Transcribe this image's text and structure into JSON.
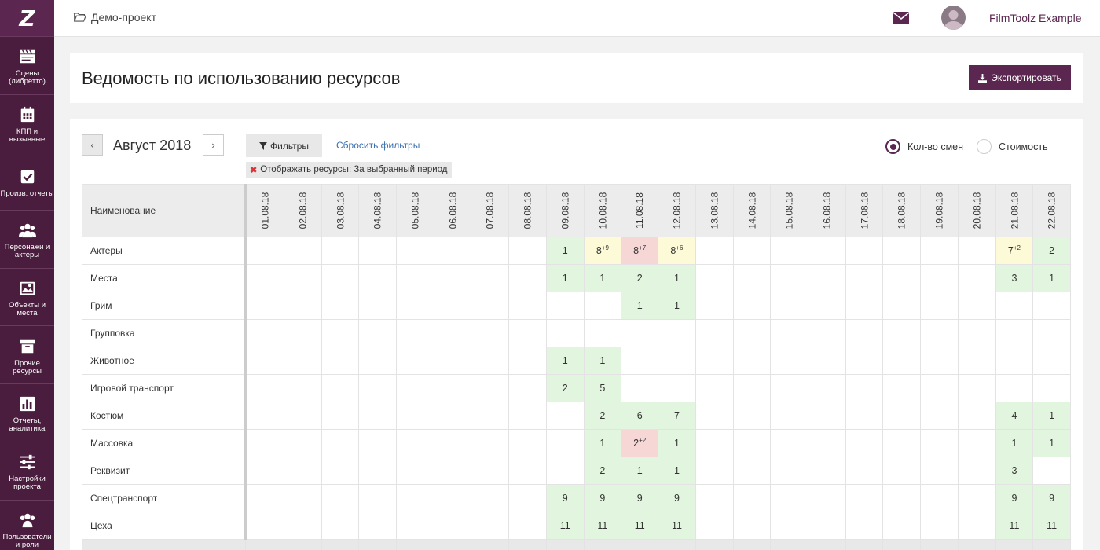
{
  "app": {
    "logo": "Z",
    "project_name": "Демо-проект",
    "user_name": "FilmToolz Example"
  },
  "sidebar": {
    "items": [
      {
        "label": "Сцены (либретто)",
        "icon": "clapperboard-icon"
      },
      {
        "label": "КПП и вызывные",
        "icon": "calendar-icon"
      },
      {
        "label": "Произв. отчеты",
        "icon": "checkbox-icon"
      },
      {
        "label": "Персонажи и актеры",
        "icon": "users-icon"
      },
      {
        "label": "Объекты и места",
        "icon": "image-icon"
      },
      {
        "label": "Прочие ресурсы",
        "icon": "archive-icon"
      },
      {
        "label": "Отчеты, аналитика",
        "icon": "bar-chart-icon"
      },
      {
        "label": "Настройки проекта",
        "icon": "sliders-icon"
      },
      {
        "label": "Пользователи и роли",
        "icon": "group-icon"
      }
    ]
  },
  "header": {
    "title": "Ведомость по использованию ресурсов",
    "export_label": "Экспортировать"
  },
  "toolbar": {
    "prev": "‹",
    "next": "›",
    "month": "Август 2018",
    "filters_label": "Фильтры",
    "reset_label": "Сбросить фильтры",
    "filter_tag": "Отображать ресурсы: За выбранный период",
    "radio_shifts": "Кол-во смен",
    "radio_cost": "Стоимость",
    "selected_mode": "shifts"
  },
  "table": {
    "name_header": "Наименование",
    "dates": [
      "01.08.18",
      "02.08.18",
      "03.08.18",
      "04.08.18",
      "05.08.18",
      "06.08.18",
      "07.08.18",
      "08.08.18",
      "09.08.18",
      "10.08.18",
      "11.08.18",
      "12.08.18",
      "13.08.18",
      "14.08.18",
      "15.08.18",
      "16.08.18",
      "17.08.18",
      "18.08.18",
      "19.08.18",
      "20.08.18",
      "21.08.18",
      "22.08.18"
    ],
    "rows": [
      {
        "name": "Актеры",
        "cells": {
          "9": [
            "1",
            "",
            "g"
          ],
          "10": [
            "8",
            "+9",
            "y"
          ],
          "11": [
            "8",
            "+7",
            "r"
          ],
          "12": [
            "8",
            "+6",
            "y"
          ],
          "21": [
            "7",
            "+2",
            "y"
          ],
          "22": [
            "2",
            "",
            "g"
          ]
        }
      },
      {
        "name": "Места",
        "cells": {
          "9": [
            "1",
            "",
            "g"
          ],
          "10": [
            "1",
            "",
            "g"
          ],
          "11": [
            "2",
            "",
            "g"
          ],
          "12": [
            "1",
            "",
            "g"
          ],
          "21": [
            "3",
            "",
            "g"
          ],
          "22": [
            "1",
            "",
            "g"
          ]
        }
      },
      {
        "name": "Грим",
        "cells": {
          "11": [
            "1",
            "",
            "g"
          ],
          "12": [
            "1",
            "",
            "g"
          ]
        }
      },
      {
        "name": "Групповка",
        "cells": {}
      },
      {
        "name": "Животное",
        "cells": {
          "9": [
            "1",
            "",
            "g"
          ],
          "10": [
            "1",
            "",
            "g"
          ]
        }
      },
      {
        "name": "Игровой транспорт",
        "cells": {
          "9": [
            "2",
            "",
            "g"
          ],
          "10": [
            "5",
            "",
            "g"
          ]
        }
      },
      {
        "name": "Костюм",
        "cells": {
          "10": [
            "2",
            "",
            "g"
          ],
          "11": [
            "6",
            "",
            "g"
          ],
          "12": [
            "7",
            "",
            "g"
          ],
          "21": [
            "4",
            "",
            "g"
          ],
          "22": [
            "1",
            "",
            "g"
          ]
        }
      },
      {
        "name": "Массовка",
        "cells": {
          "10": [
            "1",
            "",
            "g"
          ],
          "11": [
            "2",
            "+2",
            "r"
          ],
          "12": [
            "1",
            "",
            "g"
          ],
          "21": [
            "1",
            "",
            "g"
          ],
          "22": [
            "1",
            "",
            "g"
          ]
        }
      },
      {
        "name": "Реквизит",
        "cells": {
          "10": [
            "2",
            "",
            "g"
          ],
          "11": [
            "1",
            "",
            "g"
          ],
          "12": [
            "1",
            "",
            "g"
          ],
          "21": [
            "3",
            "",
            "g"
          ]
        }
      },
      {
        "name": "Спецтранспорт",
        "cells": {
          "9": [
            "9",
            "",
            "g"
          ],
          "10": [
            "9",
            "",
            "g"
          ],
          "11": [
            "9",
            "",
            "g"
          ],
          "12": [
            "9",
            "",
            "g"
          ],
          "21": [
            "9",
            "",
            "g"
          ],
          "22": [
            "9",
            "",
            "g"
          ]
        }
      },
      {
        "name": "Цеха",
        "cells": {
          "9": [
            "11",
            "",
            "g"
          ],
          "10": [
            "11",
            "",
            "g"
          ],
          "11": [
            "11",
            "",
            "g"
          ],
          "12": [
            "11",
            "",
            "g"
          ],
          "21": [
            "11",
            "",
            "g"
          ],
          "22": [
            "11",
            "",
            "g"
          ]
        }
      }
    ]
  },
  "colors": {
    "brand": "#5b2650",
    "sidebar": "#4a1d3e",
    "ok": "#e2f5de",
    "warn": "#fdfbd7",
    "over": "#f7d6d6"
  }
}
